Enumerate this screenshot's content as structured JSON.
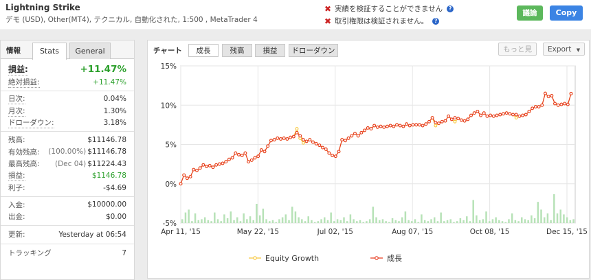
{
  "header": {
    "account_name": "Lightning Strike",
    "account_meta": "デモ (USD), Other(MT4), テクニカル, 自動化された, 1:500 , MetaTrader 4",
    "warning_track": "実績を検証することができません",
    "warning_trade": "取引権限は検証されません。",
    "help_glyph": "?",
    "discuss_label": "議論",
    "copy_label": "Copy"
  },
  "info": {
    "title": "情報",
    "tabs": [
      "Stats",
      "General"
    ],
    "gain": {
      "label": "損益:",
      "value": "+11.47%"
    },
    "abs_gain": {
      "label": "絶対損益:",
      "value": "+11.47%"
    },
    "daily": {
      "label": "日次:",
      "value": "0.04%"
    },
    "monthly": {
      "label": "月次:",
      "value": "1.30%"
    },
    "drawdown": {
      "label": "ドローダウン:",
      "value": "3.18%"
    },
    "balance": {
      "label": "残高:",
      "value": "$11146.78"
    },
    "equity": {
      "label": "有効残高:",
      "note": "(100.00%)",
      "value": "$11146.78"
    },
    "highest": {
      "label": "最高残高:",
      "note": "(Dec 04)",
      "value": "$11224.43"
    },
    "profit": {
      "label": "損益:",
      "value": "$1146.78"
    },
    "interest": {
      "label": "利子:",
      "value": "-$4.69"
    },
    "deposits": {
      "label": "入金:",
      "value": "$10000.00"
    },
    "withdrawals": {
      "label": "出金:",
      "value": "$0.00"
    },
    "updated": {
      "label": "更新:",
      "value": "Yesterday at 06:54"
    },
    "tracking": {
      "label": "トラッキング",
      "value": "7"
    }
  },
  "chart_panel": {
    "title": "チャート",
    "tabs": [
      "成長",
      "残高",
      "損益",
      "ドローダウン"
    ],
    "more_label": "もっと見",
    "export_label": "Export",
    "export_arrow": "▼"
  },
  "colors": {
    "growth_line": "#e63a1e",
    "equity_line": "#f7c73c",
    "bars": "#b7e2b7",
    "gain_green": "#2ca02c"
  },
  "chart_data": {
    "type": "line",
    "y_ticks": [
      "15%",
      "10%",
      "5%",
      "0%",
      "-5%"
    ],
    "ylim": [
      -5,
      15
    ],
    "x_ticks": [
      "Apr 11, '15",
      "May 22, '15",
      "Jul 02, '15",
      "Aug 07, '15",
      "Oct 08, '15",
      "Dec 15, '15"
    ],
    "series": [
      {
        "name": "Equity Growth",
        "values": [
          0,
          1.1,
          0.7,
          0.9,
          1.8,
          1.7,
          2.0,
          2.4,
          2.2,
          2.3,
          2.1,
          2.4,
          2.5,
          2.6,
          2.8,
          3.1,
          3.3,
          3.9,
          3.7,
          3.6,
          3.9,
          2.8,
          3.0,
          3.3,
          3.5,
          4.3,
          4.1,
          4.8,
          5.5,
          5.6,
          5.8,
          5.7,
          5.8,
          5.7,
          5.9,
          6.0,
          7.0,
          5.8,
          5.2,
          5.4,
          5.6,
          5.3,
          5.1,
          4.9,
          4.6,
          4.4,
          3.9,
          3.6,
          3.5,
          4.1,
          5.6,
          5.5,
          5.8,
          6.1,
          6.4,
          6.1,
          6.5,
          6.8,
          7.1,
          7.0,
          7.4,
          7.2,
          7.3,
          7.2,
          7.3,
          7.4,
          7.3,
          7.5,
          7.4,
          7.3,
          7.6,
          7.4,
          7.5,
          7.5,
          7.5,
          7.4,
          7.6,
          7.9,
          8.4,
          7.4,
          7.7,
          7.9,
          8.0,
          8.6,
          8.2,
          7.9,
          8.3,
          8.1,
          8.0,
          8.2,
          8.7,
          9.0,
          9.2,
          8.7,
          9.0,
          8.6,
          8.7,
          8.6,
          8.7,
          8.8,
          8.9,
          9.0,
          8.9,
          8.8,
          8.4,
          8.6,
          8.7,
          8.8,
          9.2,
          9.6,
          9.8,
          9.8,
          10.0,
          11.5,
          11.1,
          11.2,
          10.2,
          10.0,
          10.1,
          10.2,
          10.1,
          11.47
        ]
      },
      {
        "name": "成長",
        "values": [
          0,
          1.1,
          0.7,
          0.9,
          1.8,
          1.7,
          2.0,
          2.4,
          2.2,
          2.3,
          2.1,
          2.4,
          2.5,
          2.6,
          2.8,
          3.1,
          3.3,
          3.9,
          3.7,
          3.6,
          3.9,
          2.8,
          3.0,
          3.3,
          3.5,
          4.3,
          4.1,
          4.8,
          5.5,
          5.6,
          5.8,
          5.7,
          5.8,
          5.7,
          5.9,
          6.0,
          6.5,
          6.1,
          5.6,
          5.4,
          5.6,
          5.3,
          5.1,
          4.9,
          4.6,
          4.4,
          3.9,
          3.6,
          3.5,
          4.1,
          5.6,
          5.5,
          5.8,
          6.1,
          6.4,
          6.1,
          6.5,
          6.8,
          7.1,
          7.0,
          7.4,
          7.2,
          7.3,
          7.2,
          7.3,
          7.4,
          7.3,
          7.5,
          7.4,
          7.3,
          7.6,
          7.4,
          7.5,
          7.5,
          7.5,
          7.4,
          7.6,
          7.9,
          8.4,
          7.8,
          7.7,
          7.9,
          8.0,
          8.6,
          8.2,
          8.4,
          8.3,
          8.1,
          8.0,
          8.2,
          8.7,
          9.0,
          9.2,
          8.7,
          9.0,
          8.6,
          8.7,
          8.6,
          8.7,
          8.8,
          8.9,
          9.0,
          8.9,
          8.8,
          8.8,
          8.6,
          8.7,
          8.8,
          9.2,
          9.6,
          9.8,
          9.8,
          10.0,
          11.5,
          11.1,
          11.2,
          10.2,
          10.0,
          10.1,
          10.2,
          10.1,
          11.47
        ]
      }
    ],
    "bars_relative": [
      0.2,
      0.55,
      0.7,
      0.1,
      0.5,
      0.15,
      0.2,
      0.3,
      0.15,
      0.1,
      0.55,
      0.2,
      0.1,
      0.45,
      0.25,
      0.6,
      0.15,
      0.3,
      0.1,
      0.5,
      0.2,
      0.35,
      0.15,
      1.0,
      0.4,
      0.75,
      0.2,
      0.1,
      0.15,
      0.05,
      0.2,
      0.3,
      0.45,
      0.15,
      0.85,
      0.6,
      0.3,
      0.2,
      0.1,
      0.35,
      0.15,
      0.05,
      0.1,
      0.2,
      0.3,
      0.15,
      0.55,
      0.1,
      0.2,
      0.15,
      0.3,
      0.1,
      0.45,
      0.2,
      0.1,
      0.15,
      0.05,
      0.1,
      0.2,
      0.85,
      0.3,
      0.15,
      0.2,
      0.1,
      0.05,
      0.25,
      0.15,
      0.1,
      0.3,
      0.6,
      0.15,
      0.1,
      0.2,
      0.05,
      0.45,
      0.15,
      0.1,
      0.2,
      0.3,
      0.1,
      0.55,
      0.1,
      0.15,
      0.2,
      0.05,
      0.1,
      0.25,
      0.15,
      0.35,
      0.1,
      1.2,
      0.4,
      0.15,
      0.2,
      0.6,
      0.1,
      0.2,
      0.3,
      0.15,
      0.1,
      0.05,
      0.2,
      0.5,
      0.15,
      0.1,
      0.3,
      0.2,
      0.15,
      0.4,
      0.25,
      1.1,
      0.7,
      0.3,
      0.5,
      0.15,
      1.5,
      0.5,
      0.7,
      0.45,
      0.3,
      0.15,
      0.2
    ],
    "legend": [
      "Equity Growth",
      "成長"
    ],
    "legend_position": "bottom"
  }
}
